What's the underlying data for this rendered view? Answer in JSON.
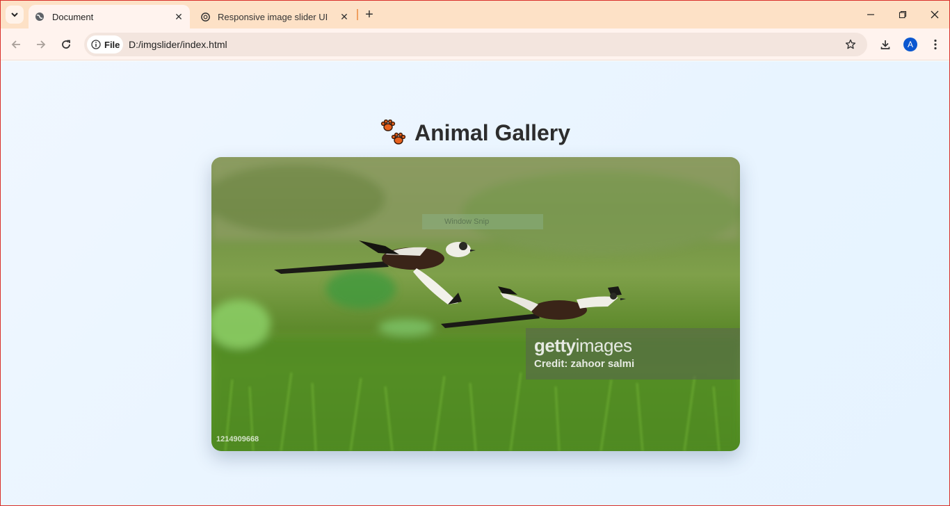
{
  "browser": {
    "tabs": [
      {
        "title": "Document",
        "active": true,
        "icon": "globe-icon"
      },
      {
        "title": "Responsive image slider UI",
        "active": false,
        "icon": "chatgpt-icon"
      }
    ],
    "omnibox": {
      "chip_label": "File",
      "url": "D:/imgslider/index.html"
    },
    "profile_initial": "A",
    "colors": {
      "tabstrip": "#fde1c6",
      "toolbar": "#fff3ee",
      "avatar": "#0b57d0"
    }
  },
  "page": {
    "heading": "Animal Gallery",
    "heading_icon": "paw-prints-icon",
    "slide": {
      "snip_overlay": "Window Snip",
      "watermark_brand_bold": "getty",
      "watermark_brand_light": "images",
      "watermark_credit": "Credit: zahoor salmi",
      "image_id": "1214909668"
    }
  }
}
